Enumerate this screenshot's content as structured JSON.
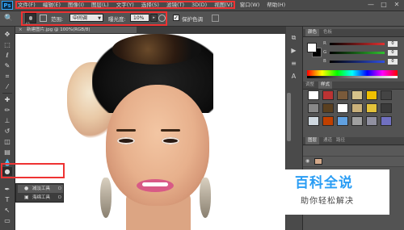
{
  "app": {
    "logo": "Ps"
  },
  "menu": [
    "文件(F)",
    "编辑(E)",
    "图像(I)",
    "图层(L)",
    "文字(Y)",
    "选择(S)",
    "滤镜(T)",
    "3D(D)",
    "视图(V)",
    "窗口(W)",
    "帮助(H)"
  ],
  "window_controls": [
    "—",
    "□",
    "✕"
  ],
  "options_bar": {
    "brush_size": "65",
    "range_label": "范围:",
    "range_value": "中间调",
    "exposure_label": "曝光度:",
    "exposure_value": "10%",
    "protect_tones_label": "保护色调",
    "protect_tones_checked": true
  },
  "document": {
    "tab_title": "新建图片.jpg @ 100%(RGB/8)",
    "close_glyph": "×"
  },
  "tools_flyout": {
    "items": [
      {
        "label": "减淡工具",
        "shortcut": "O",
        "selected": true
      },
      {
        "label": "海绵工具",
        "shortcut": "O",
        "selected": false
      }
    ]
  },
  "color_panel": {
    "tabs": [
      "颜色",
      "色板"
    ],
    "channels": [
      {
        "label": "R",
        "value": "0",
        "color": "#e03030"
      },
      {
        "label": "G",
        "value": "0",
        "color": "#30c030"
      },
      {
        "label": "B",
        "value": "0",
        "color": "#3050e0"
      }
    ]
  },
  "styles_panel": {
    "tabs": [
      "调整",
      "样式"
    ],
    "swatch_colors": [
      "#ffffff",
      "#b33",
      "#7a5a3a",
      "#d6c28a",
      "#f0c000",
      "#444444",
      "#888888",
      "#5a4020",
      "#ffffff",
      "#c9b07a",
      "#e3c23a",
      "#3a3a3a",
      "#cfd8e0",
      "#c04000",
      "#60a0e0",
      "#a0a0a0",
      "#9090a0",
      "#7070c0"
    ]
  },
  "layers_panel": {
    "tabs": [
      "图层",
      "通道",
      "路径"
    ],
    "rows": [
      {
        "color": "#d4a98a"
      },
      {
        "color": "#d4a98a"
      }
    ]
  },
  "watermark": {
    "title": "百科全说",
    "subtitle": "助你轻松解决"
  }
}
